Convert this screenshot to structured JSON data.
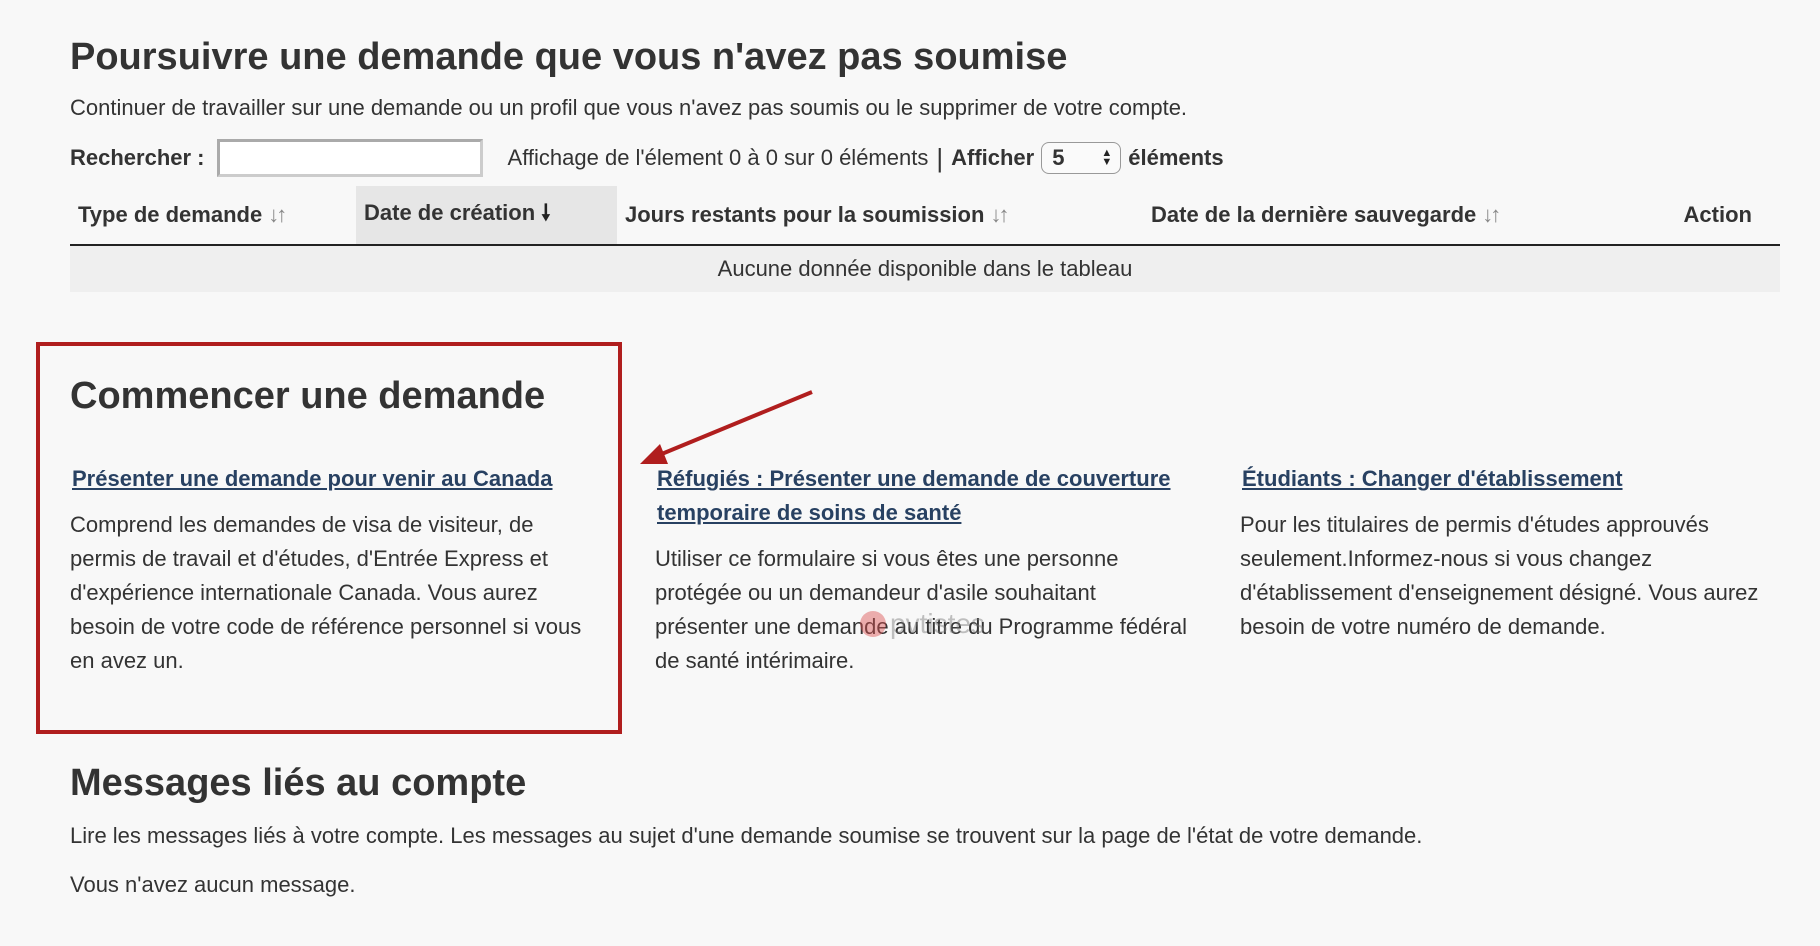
{
  "continue_section": {
    "title": "Poursuivre une demande que vous n'avez pas soumise",
    "description": "Continuer de travailler sur une demande ou un profil que vous n'avez pas soumis ou le supprimer de votre compte.",
    "search_label": "Rechercher :",
    "search_value": "",
    "info_text": "Affichage de l'élement 0 à 0 sur 0 éléments",
    "separator": "|",
    "show_label": "Afficher",
    "page_size": "5",
    "items_label": "éléments",
    "table": {
      "columns": [
        "Type de demande",
        "Date de création",
        "Jours restants pour la soumission",
        "Date de la dernière sauvegarde",
        "Action"
      ],
      "empty_message": "Aucune donnée disponible dans le tableau"
    }
  },
  "start_section": {
    "title": "Commencer une demande",
    "cards": [
      {
        "link": "Présenter une demande pour venir au Canada",
        "description": "Comprend les demandes de visa de visiteur, de permis de travail et d'études, d'Entrée Express et d'expérience internationale Canada. Vous aurez besoin de votre code de référence personnel si vous en avez un."
      },
      {
        "link": "Réfugiés : Présenter une demande de couverture temporaire de soins de santé",
        "description": "Utiliser ce formulaire si vous êtes une personne protégée ou un demandeur d'asile souhaitant présenter une demande au titre du Programme fédéral de santé intérimaire."
      },
      {
        "link": "Étudiants : Changer d'établissement",
        "description": "Pour les titulaires de permis d'études approuvés seulement.Informez-nous si vous changez d'établissement d'enseignement désigné. Vous aurez besoin de votre numéro de demande."
      }
    ]
  },
  "messages_section": {
    "title": "Messages liés au compte",
    "description": "Lire les messages liés à votre compte. Les messages au sujet d'une demande soumise se trouvent sur la page de l'état de votre demande.",
    "empty_message": "Vous n'avez aucun message."
  },
  "watermark": "pvtistes",
  "colors": {
    "highlight": "#b01e1e",
    "link": "#284162",
    "background": "#f8f8f8"
  }
}
